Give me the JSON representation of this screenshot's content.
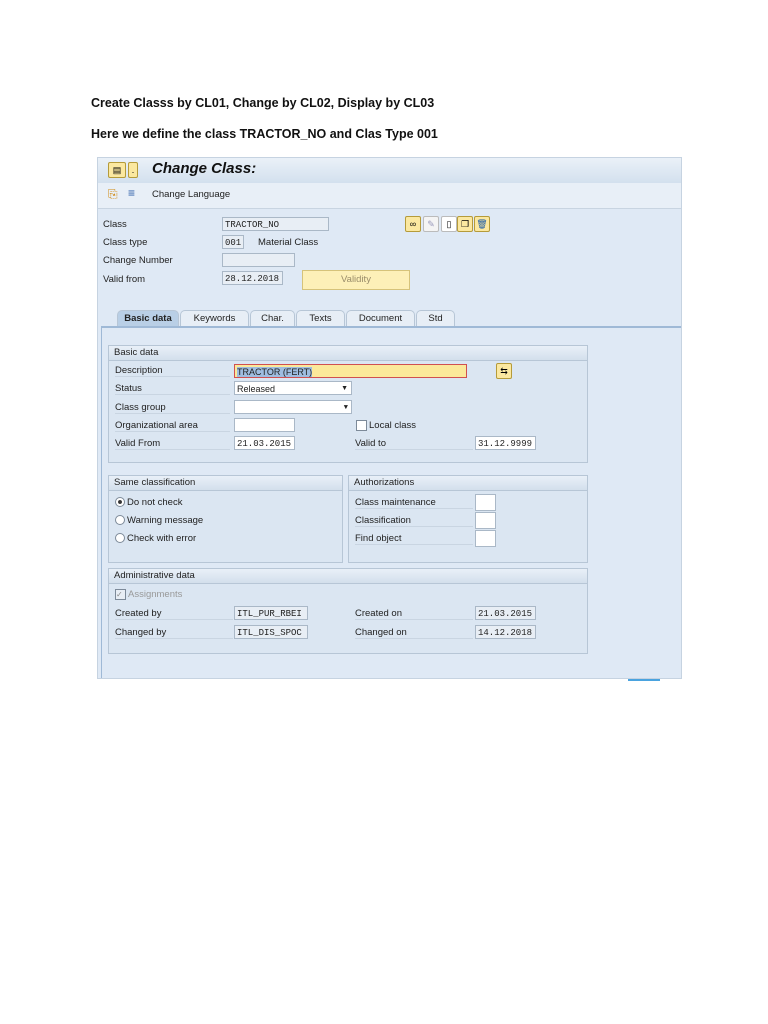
{
  "doc": {
    "line1": "Create Classs by CL01, Change by CL02, Display by CL03",
    "line2": "Here we define the class TRACTOR_NO and Clas Type 001"
  },
  "window": {
    "title": "Change Class:",
    "toolbar": {
      "change_language": "Change Language"
    }
  },
  "header": {
    "class_label": "Class",
    "class_value": "TRACTOR_NO",
    "class_type_label": "Class type",
    "class_type_value": "001",
    "class_type_desc": "Material Class",
    "change_number_label": "Change Number",
    "change_number_value": "",
    "valid_from_label": "Valid from",
    "valid_from_value": "28.12.2018",
    "validity_button": "Validity"
  },
  "tabs": [
    "Basic data",
    "Keywords",
    "Char.",
    "Texts",
    "Document",
    "Std"
  ],
  "basic": {
    "title": "Basic data",
    "description_label": "Description",
    "description_value": "TRACTOR (FERT)",
    "status_label": "Status",
    "status_value": "Released",
    "class_group_label": "Class group",
    "class_group_value": "",
    "org_area_label": "Organizational area",
    "org_area_value": "",
    "local_class_label": "Local class",
    "valid_from_label": "Valid From",
    "valid_from_value": "21.03.2015",
    "valid_to_label": "Valid to",
    "valid_to_value": "31.12.9999"
  },
  "same": {
    "title": "Same classification",
    "options": [
      "Do not check",
      "Warning message",
      "Check with error"
    ],
    "selected": 0
  },
  "auth": {
    "title": "Authorizations",
    "class_maintenance": "Class maintenance",
    "classification": "Classification",
    "find_object": "Find object"
  },
  "admin": {
    "title": "Administrative data",
    "assignments": "Assignments",
    "created_by_label": "Created by",
    "created_by_value": "ITL_PUR_RBEI",
    "changed_by_label": "Changed by",
    "changed_by_value": "ITL_DIS_SPOC",
    "created_on_label": "Created on",
    "created_on_value": "21.03.2015",
    "changed_on_label": "Changed on",
    "changed_on_value": "14.12.2018"
  }
}
